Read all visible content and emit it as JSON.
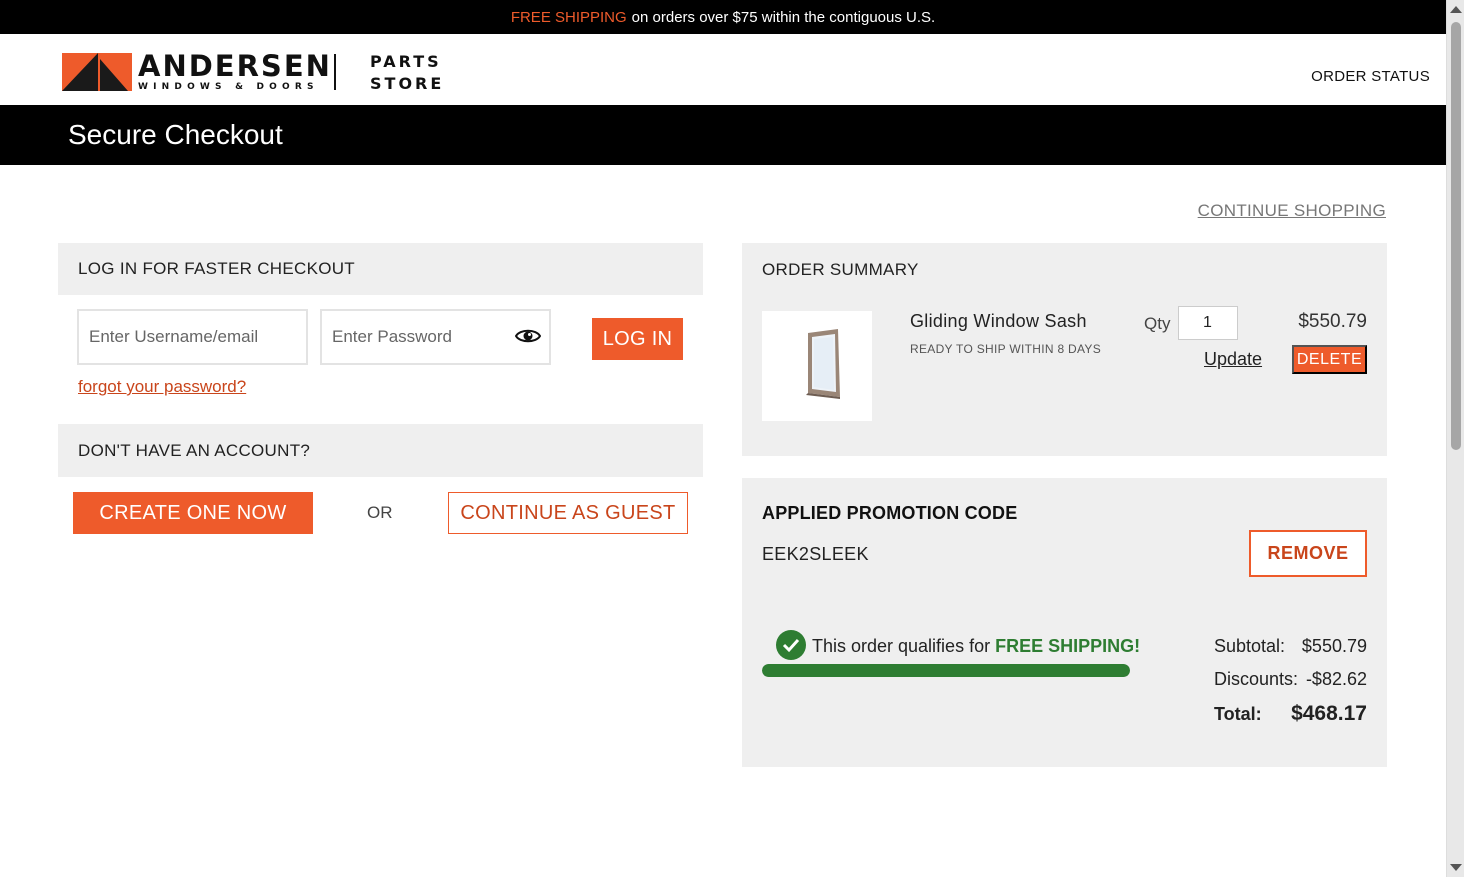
{
  "announcement": {
    "highlight": "FREE SHIPPING",
    "text": "on orders over $75 within the contiguous U.S."
  },
  "brand": {
    "name": "ANDERSEN",
    "tm": "™",
    "tagline": "WINDOWS & DOORS",
    "store_line1": "PARTS",
    "store_line2": "STORE"
  },
  "nav": {
    "order_status": "ORDER STATUS"
  },
  "page": {
    "title": "Secure Checkout",
    "continue_shopping": "CONTINUE SHOPPING"
  },
  "login": {
    "heading": "LOG IN FOR FASTER CHECKOUT",
    "username_placeholder": "Enter Username/email",
    "password_placeholder": "Enter Password",
    "login_button": "LOG IN",
    "forgot": "forgot your password?"
  },
  "signup": {
    "heading": "DON'T HAVE AN ACCOUNT?",
    "create_button": "CREATE ONE NOW",
    "or": "OR",
    "guest_button": "CONTINUE AS GUEST"
  },
  "order_summary": {
    "heading": "ORDER SUMMARY",
    "item": {
      "name": "Gliding Window Sash",
      "ship_note": "READY TO SHIP WITHIN 8 DAYS",
      "qty_label": "Qty",
      "qty": "1",
      "price": "$550.79",
      "update": "Update",
      "delete": "DELETE"
    }
  },
  "promotion": {
    "heading": "APPLIED PROMOTION CODE",
    "code": "EEK2SLEEK",
    "remove": "REMOVE",
    "shipping_text": "This order qualifies for",
    "shipping_highlight": "FREE SHIPPING!",
    "shipping_progress_percent": 100
  },
  "totals": {
    "subtotal_label": "Subtotal:",
    "subtotal": "$550.79",
    "discounts_label": "Discounts:",
    "discounts": "-$82.62",
    "total_label": "Total:",
    "total": "$468.17"
  },
  "colors": {
    "accent": "#ee5b2b",
    "success": "#2e7d32",
    "panel": "#efefef"
  }
}
